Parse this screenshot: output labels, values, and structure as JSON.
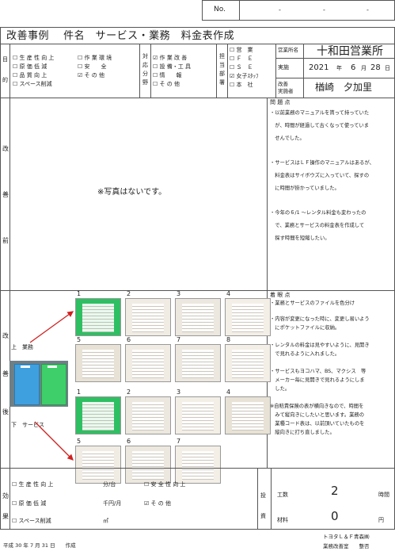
{
  "header": {
    "no_label": "No.",
    "dash1": "-",
    "dash2": "-",
    "dash3": "-"
  },
  "title": "改善事例　 件名　サービス・業務　料金表作成",
  "categories": {
    "col1_label": [
      "目",
      "的"
    ],
    "col1": [
      {
        "label": "生 産 性 向 上",
        "checked": false
      },
      {
        "label": "原 価 低 減",
        "checked": false
      },
      {
        "label": "品 質 向 上",
        "checked": false
      },
      {
        "label": "スペース削減",
        "checked": false
      }
    ],
    "col2": [
      {
        "label": "作 業 環 境",
        "checked": false
      },
      {
        "label": "安　　全",
        "checked": false
      },
      {
        "label": "そ の 他",
        "checked": true
      }
    ],
    "col3_label": [
      "対",
      "応",
      "分",
      "野"
    ],
    "col3": [
      {
        "label": "作 業 改 善",
        "checked": true
      },
      {
        "label": "設 備・工 具",
        "checked": false
      },
      {
        "label": "情　　報",
        "checked": false
      },
      {
        "label": "そ の 他",
        "checked": false
      }
    ],
    "col4_label": [
      "担",
      "当",
      "部",
      "署"
    ],
    "col4": [
      {
        "label": "営　業",
        "checked": false
      },
      {
        "label": "Ｆ　Ｅ",
        "checked": false
      },
      {
        "label": "Ｓ　Ｅ",
        "checked": false
      },
      {
        "label": "女子ｽﾀｯﾌ",
        "checked": true
      },
      {
        "label": "本　社",
        "checked": false
      }
    ]
  },
  "office": {
    "office_label": "営業所名",
    "office_name": "十和田営業所",
    "date_label": "実施",
    "year": "2021",
    "year_unit": "年",
    "month": "6",
    "month_unit": "月",
    "day": "28",
    "day_unit": "日",
    "person_label_1": "改善",
    "person_label_2": "実施者",
    "person_name": "楢崎　夕加里"
  },
  "before": {
    "side_label": [
      "改",
      "善",
      "前"
    ],
    "photo_note": "※写真はないです。",
    "problem_title": "問 題 点",
    "problems": [
      "・以前業務のマニュアルを貰って持っていた",
      "　が、時間が経過して古くなって使っていま",
      "　せんでした。",
      "・サービスはＬＦ操作のマニュアルはあるが、",
      "　料金表はサイボウズに入っていて、探すの",
      "　に時間が掛かっていました。",
      "・今年の６/1 ～レンタル料金も変わったの",
      "　で、業務とサービスの料金表を作成して",
      "　探す時間を短縮したい。"
    ]
  },
  "after": {
    "side_label": [
      "改",
      "善",
      "後"
    ],
    "upper_label": "上　業務",
    "lower_label": "下　サービス",
    "upper_nums": [
      "1",
      "2",
      "3",
      "4",
      "5",
      "6",
      "7",
      "8"
    ],
    "lower_nums": [
      "1",
      "2",
      "3",
      "4",
      "5",
      "6",
      "7"
    ],
    "point_title": "着 眼 点",
    "points": [
      "・業務とサービスのファイルを色分け",
      "・内容が変更になった時に、変更し易いよう",
      "　にポケットファイルに収納。",
      "・レンタルの料金は見やすいように、見開き",
      "　で見れるように入れました。",
      "・サービスもヨコハマ、BS、マクシス　等",
      "　メーカー毎に見開きで見れるようにしま",
      "　した。",
      "※自賠責保険の表が横向きなので、時間を",
      "　みて縦向きにしたいと思います。業務の",
      "　業種コード表は、以前頂いていたものを",
      "　縦向きに打ち直しました。"
    ]
  },
  "effect": {
    "side_label": [
      "効",
      "果"
    ],
    "rows": [
      {
        "label": "生 産 性 向 上",
        "unit": "分/台",
        "checked": false
      },
      {
        "label": "原 価 低 減",
        "unit": "千円/月",
        "checked": false
      },
      {
        "label": "スペース削減",
        "unit": "㎡",
        "checked": false
      }
    ],
    "mid": [
      {
        "label": "安 全 性 向 上",
        "checked": false
      },
      {
        "label": "そ の 他",
        "checked": true
      }
    ],
    "invest_label": [
      "投",
      "資"
    ],
    "kosu_label": "工数",
    "kosu_value": "2",
    "kosu_unit": "時間",
    "zairyo_label": "材料",
    "zairyo_value": "0",
    "zairyo_unit": "円"
  },
  "footer": {
    "date": "平成 30 年 7 月 31 日　　作成",
    "company": "トヨタＬ＆Ｆ青森㈱",
    "dept": "業務改善室　　整否"
  }
}
